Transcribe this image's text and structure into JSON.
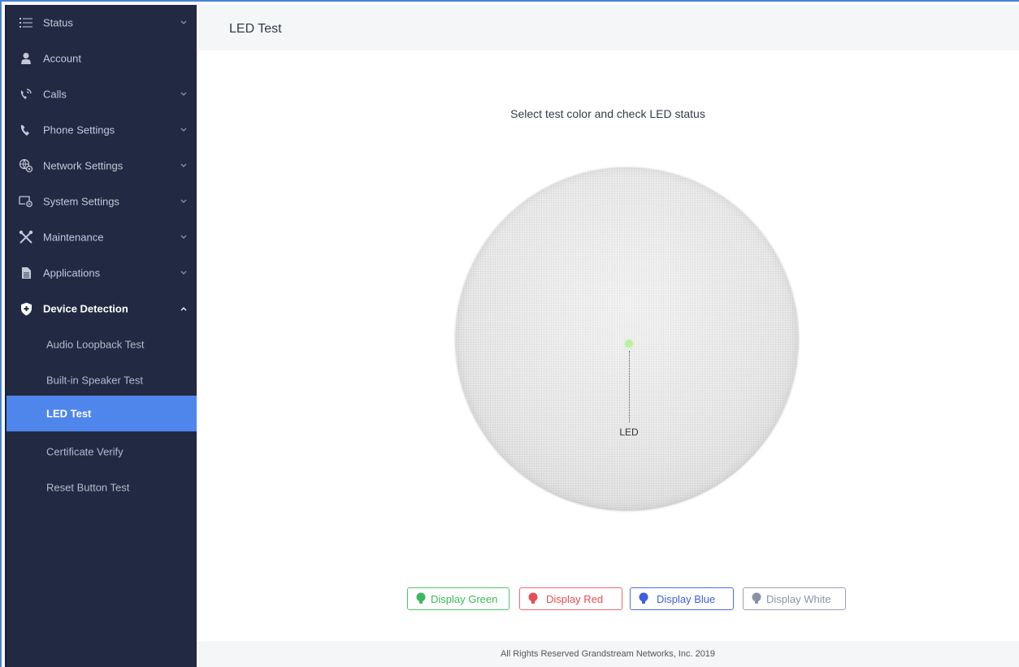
{
  "sidebar": {
    "items": [
      {
        "label": "Status",
        "icon": "list-icon",
        "chevron": "down"
      },
      {
        "label": "Account",
        "icon": "person-icon",
        "chevron": ""
      },
      {
        "label": "Calls",
        "icon": "phone-ringing-icon",
        "chevron": "down"
      },
      {
        "label": "Phone Settings",
        "icon": "phone-icon",
        "chevron": "down"
      },
      {
        "label": "Network Settings",
        "icon": "globe-gear-icon",
        "chevron": "down"
      },
      {
        "label": "System Settings",
        "icon": "monitor-gear-icon",
        "chevron": "down"
      },
      {
        "label": "Maintenance",
        "icon": "tools-icon",
        "chevron": "down"
      },
      {
        "label": "Applications",
        "icon": "document-icon",
        "chevron": "down"
      },
      {
        "label": "Device Detection",
        "icon": "shield-plus-icon",
        "chevron": "up"
      }
    ],
    "sub_items": [
      {
        "label": "Audio Loopback Test"
      },
      {
        "label": "Built-in Speaker Test"
      },
      {
        "label": "LED Test"
      },
      {
        "label": "Certificate Verify"
      },
      {
        "label": "Reset Button Test"
      }
    ]
  },
  "header": {
    "title": "LED Test"
  },
  "main": {
    "instruction": "Select test color and check LED status",
    "led_label": "LED",
    "buttons": {
      "green": "Display Green",
      "red": "Display Red",
      "blue": "Display Blue",
      "white": "Display White"
    }
  },
  "footer": {
    "text": "All Rights Reserved Grandstream Networks, Inc. 2019"
  },
  "colors": {
    "sidebar_bg": "#212a42",
    "selected_bg": "#4f86ec",
    "led_current": "#b8f2a0",
    "green": "#3cb95c",
    "red": "#e24f54",
    "blue": "#3e5fe0",
    "white": "#8a93a6"
  }
}
